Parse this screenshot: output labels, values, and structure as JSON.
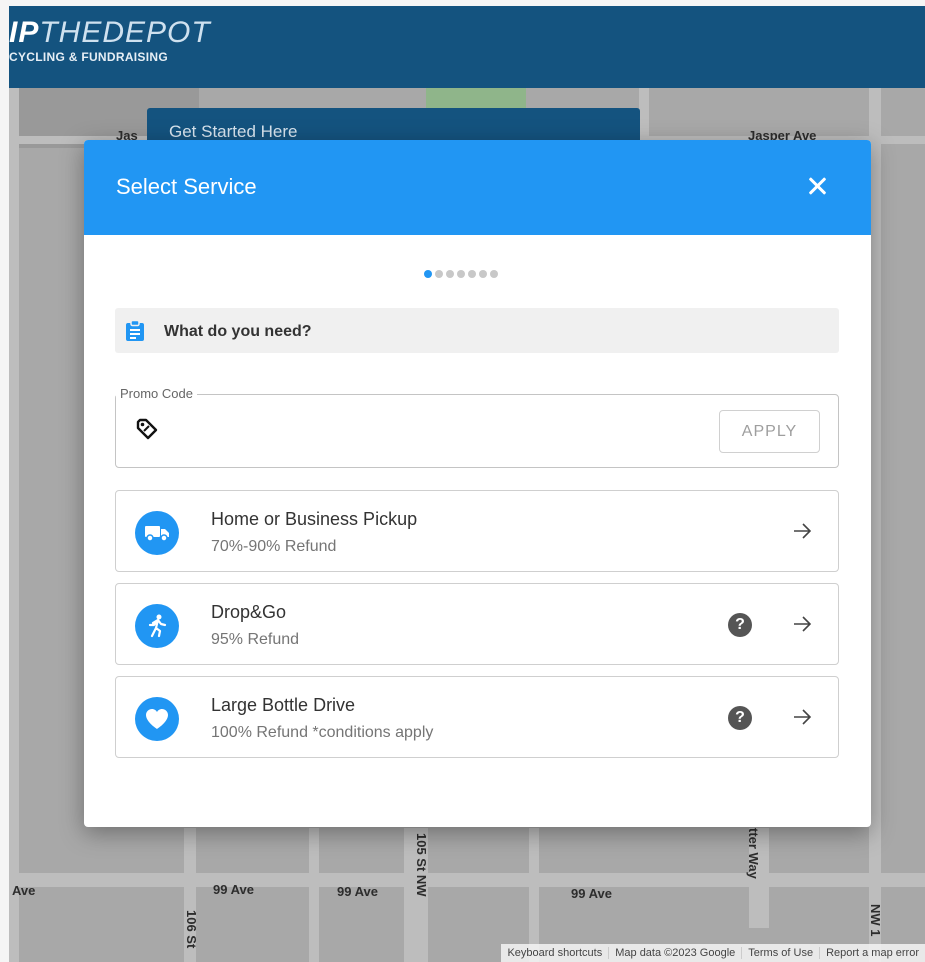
{
  "header": {
    "logo_bold": "IP",
    "logo_light": "THEDEPOT",
    "logo_sub": "CYCLING & FUNDRAISING"
  },
  "map": {
    "get_started": "Get Started Here",
    "labels": {
      "jasper_left": "Jas",
      "jasper_right": "Jasper Ave",
      "ave_left": "Ave",
      "ave_99_a": "99 Ave",
      "ave_99_b": "99 Ave",
      "ave_99_c": "99 Ave",
      "st_105": "105 St NW",
      "st_106": "106 St",
      "tter_way": "tter Way",
      "nw_right": "NW 1"
    },
    "footer": {
      "shortcuts": "Keyboard shortcuts",
      "map_data": "Map data ©2023 Google",
      "terms": "Terms of Use",
      "report": "Report a map error"
    }
  },
  "modal": {
    "title": "Select Service",
    "steps_total": 7,
    "step_current": 1,
    "section_heading": "What do you need?",
    "promo": {
      "label": "Promo Code",
      "value": "",
      "placeholder": "",
      "apply_label": "APPLY"
    },
    "services": [
      {
        "title": "Home or Business Pickup",
        "subtitle": "70%-90% Refund",
        "icon": "truck-icon",
        "help": false
      },
      {
        "title": "Drop&Go",
        "subtitle": "95% Refund",
        "icon": "running-person-icon",
        "help": true
      },
      {
        "title": "Large Bottle Drive",
        "subtitle": "100% Refund *conditions apply",
        "icon": "heart-icon",
        "help": true
      }
    ]
  },
  "colors": {
    "header_bg": "#14537f",
    "modal_header_bg": "#2196f3",
    "accent": "#2196f3"
  }
}
